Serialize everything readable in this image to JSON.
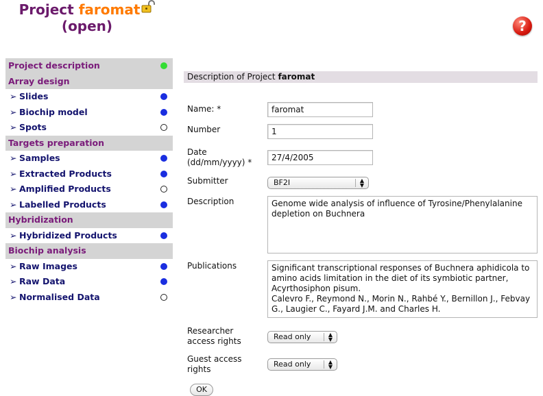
{
  "header": {
    "title_prefix": "Project",
    "project_name": "faromat",
    "status": "(open)",
    "help_glyph": "?"
  },
  "sidebar": {
    "rows": [
      {
        "kind": "section",
        "label": "Project description",
        "status": "green"
      },
      {
        "kind": "section",
        "label": "Array design",
        "status": ""
      },
      {
        "kind": "item",
        "label": "Slides",
        "status": "blue"
      },
      {
        "kind": "item",
        "label": "Biochip model",
        "status": "blue"
      },
      {
        "kind": "item",
        "label": "Spots",
        "status": "empty"
      },
      {
        "kind": "section",
        "label": "Targets preparation",
        "status": ""
      },
      {
        "kind": "item",
        "label": "Samples",
        "status": "blue"
      },
      {
        "kind": "item",
        "label": "Extracted Products",
        "status": "blue"
      },
      {
        "kind": "item",
        "label": "Amplified Products",
        "status": "empty"
      },
      {
        "kind": "item",
        "label": "Labelled Products",
        "status": "blue"
      },
      {
        "kind": "section",
        "label": "Hybridization",
        "status": ""
      },
      {
        "kind": "item",
        "label": "Hybridized Products",
        "status": "blue"
      },
      {
        "kind": "section",
        "label": "Biochip analysis",
        "status": ""
      },
      {
        "kind": "item",
        "label": "Raw Images",
        "status": "blue"
      },
      {
        "kind": "item",
        "label": "Raw Data",
        "status": "blue"
      },
      {
        "kind": "item",
        "label": "Normalised Data",
        "status": "empty"
      }
    ]
  },
  "form": {
    "heading_prefix": "Description of Project",
    "heading_project": "faromat",
    "name_label": "Name: *",
    "name_value": "faromat",
    "number_label": "Number",
    "number_value": "1",
    "date_label_1": "Date",
    "date_label_2": "(dd/mm/yyyy) *",
    "date_value": "27/4/2005",
    "submitter_label": "Submitter",
    "submitter_value": "BF2I",
    "description_label": "Description",
    "description_value": "Genome wide analysis of influence of Tyrosine/Phenylalanine depletion on Buchnera",
    "publications_label": "Publications",
    "publications_value": "Significant transcriptional responses of Buchnera aphidicola to amino acids limitation in the diet of its symbiotic partner, Acyrthosiphon pisum.\nCalevro F., Reymond N., Morin N., Rahbé Y., Bernillon J., Febvay G., Laugier C., Fayard J.M. and Charles H.",
    "researcher_label_1": "Researcher",
    "researcher_label_2": "access rights",
    "researcher_value": "Read only",
    "guest_label_1": "Guest access",
    "guest_label_2": "rights",
    "guest_value": "Read only",
    "ok_label": "OK"
  },
  "colors": {
    "accent_purple": "#6b1a6b",
    "project_orange": "#ff7a00",
    "section_bg": "#d4d4d4",
    "status_blue": "#1a2ee0",
    "status_green": "#33dd33"
  }
}
